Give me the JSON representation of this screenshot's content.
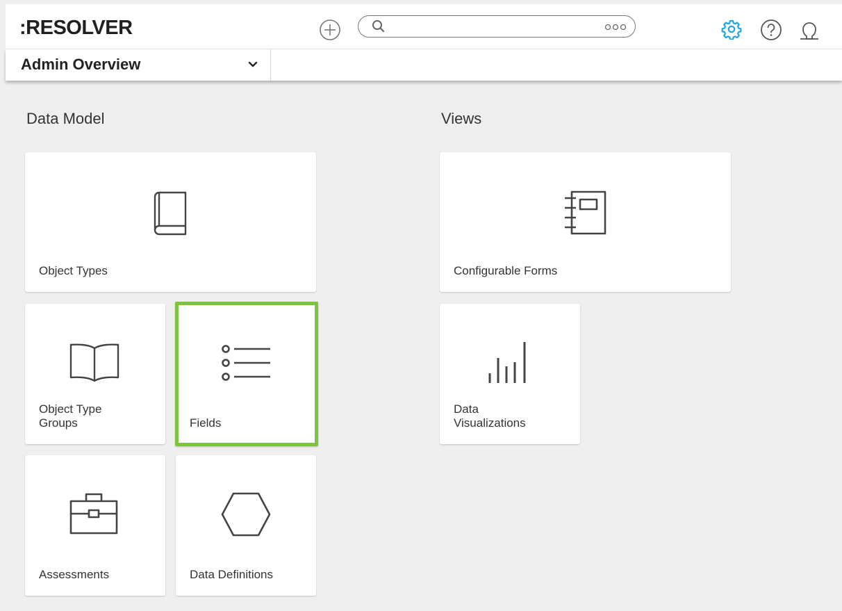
{
  "header": {
    "logo_text": ":RESOLVER",
    "search": {
      "value": "",
      "placeholder": ""
    },
    "icons": [
      "add-icon",
      "search-icon",
      "more-icon",
      "gear-icon",
      "help-icon",
      "user-icon"
    ],
    "colors": {
      "gear": "#1fa5e0",
      "icon": "#555555"
    }
  },
  "subheader": {
    "dropdown_label": "Admin Overview"
  },
  "sections": {
    "data_model": {
      "title": "Data Model",
      "cards": {
        "object_types": "Object Types",
        "object_type_groups": "Object Type Groups",
        "fields": "Fields",
        "assessments": "Assessments",
        "data_definitions": "Data Definitions"
      }
    },
    "views": {
      "title": "Views",
      "cards": {
        "configurable_forms": "Configurable Forms",
        "data_visualizations": "Data Visualizations"
      }
    }
  },
  "selected_card": "Fields",
  "colors": {
    "selected_border": "#7dc241",
    "background": "#efefef"
  }
}
